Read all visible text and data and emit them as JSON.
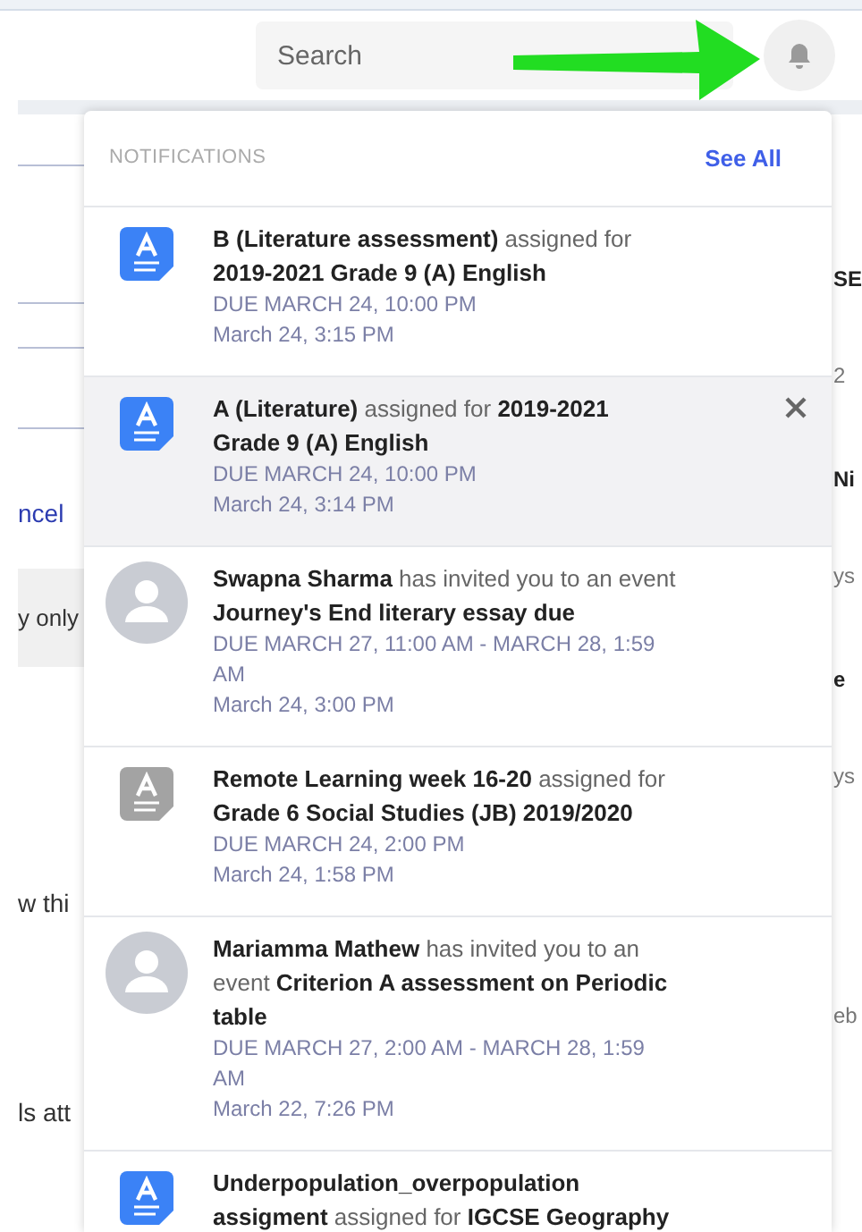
{
  "search": {
    "placeholder": "Search"
  },
  "background_left": [
    {
      "text": "ncel",
      "kind": "link"
    },
    {
      "text": "y only",
      "kind": "banner"
    },
    {
      "text": "w thi",
      "kind": "text"
    },
    {
      "text": "ls att",
      "kind": "text"
    }
  ],
  "background_right": [
    {
      "text": "SE",
      "kind": "heading"
    },
    {
      "text": "2",
      "kind": "text"
    },
    {
      "text": "Ni",
      "kind": "heading"
    },
    {
      "text": "ys",
      "kind": "text"
    },
    {
      "text": "e",
      "kind": "heading"
    },
    {
      "text": "ys",
      "kind": "text"
    },
    {
      "text": "eb",
      "kind": "text"
    }
  ],
  "notifications": {
    "title": "NOTIFICATIONS",
    "see_all": "See All",
    "items": [
      {
        "kind": "assignment",
        "color": "#3b82f6",
        "selected": false,
        "text": "**B (Literature assessment)** assigned for **2019-2021 Grade 9 (A) English**",
        "due": "DUE MARCH 24, 10:00 PM",
        "time": "March 24, 3:15 PM"
      },
      {
        "kind": "assignment",
        "color": "#3b82f6",
        "selected": true,
        "text": "**A (Literature)** assigned for **2019-2021 Grade 9 (A) English**",
        "due": "DUE MARCH 24, 10:00 PM",
        "time": "March 24, 3:14 PM"
      },
      {
        "kind": "invite",
        "selected": false,
        "text": "**Swapna Sharma** has invited you to an event **Journey's End literary essay due**",
        "due": "DUE MARCH 27, 11:00 AM - MARCH 28, 1:59 AM",
        "time": "March 24, 3:00 PM"
      },
      {
        "kind": "assignment",
        "color": "#a3a3a3",
        "selected": false,
        "text": "**Remote Learning week 16-20** assigned for **Grade 6 Social Studies (JB) 2019/2020**",
        "due": "DUE MARCH 24, 2:00 PM",
        "time": "March 24, 1:58 PM"
      },
      {
        "kind": "invite",
        "selected": false,
        "text": "**Mariamma Mathew** has invited you to an event **Criterion A assessment on Periodic table**",
        "due": "DUE MARCH 27, 2:00 AM - MARCH 28, 1:59 AM",
        "time": "March 22, 7:26 PM"
      },
      {
        "kind": "assignment",
        "color": "#3b82f6",
        "selected": false,
        "text": "**Underpopulation_overpopulation assigment** assigned for **IGCSE Geography**"
      }
    ]
  }
}
